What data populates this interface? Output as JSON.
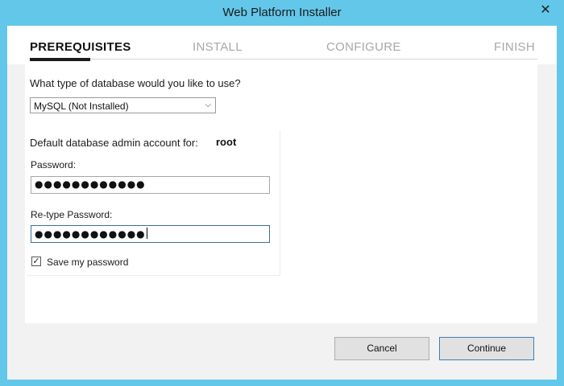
{
  "window": {
    "title": "Web Platform Installer",
    "close_glyph": "✕"
  },
  "steps": [
    {
      "label": "PREREQUISITES",
      "active": true
    },
    {
      "label": "INSTALL",
      "active": false
    },
    {
      "label": "CONFIGURE",
      "active": false
    },
    {
      "label": "FINISH",
      "active": false
    }
  ],
  "database": {
    "question": "What type of database would you like to use?",
    "selected": "MySQL (Not Installed)",
    "arrow_glyph": "⌵"
  },
  "account": {
    "label": "Default database admin account for:",
    "user": "root",
    "password_label": "Password:",
    "password_value": "●●●●●●●●●●●●",
    "retype_label": "Re-type Password:",
    "retype_value": "●●●●●●●●●●●●",
    "save_checked": true,
    "save_label": "Save my password",
    "check_glyph": "✓"
  },
  "buttons": {
    "cancel": "Cancel",
    "continue": "Continue"
  },
  "colors": {
    "frame": "#63c7ea",
    "accent": "#3c7fb1"
  }
}
